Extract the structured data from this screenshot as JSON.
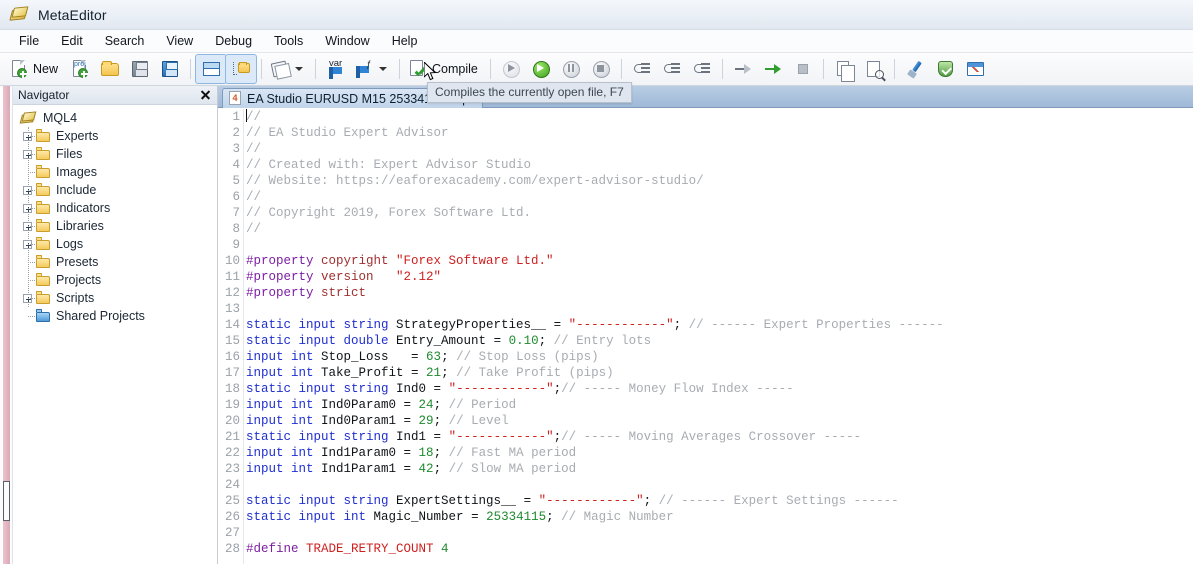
{
  "window": {
    "title": "MetaEditor",
    "logo_icon": "metaeditor-logo-icon"
  },
  "menubar": {
    "items": [
      {
        "label": "File"
      },
      {
        "label": "Edit"
      },
      {
        "label": "Search"
      },
      {
        "label": "View"
      },
      {
        "label": "Debug"
      },
      {
        "label": "Tools"
      },
      {
        "label": "Window"
      },
      {
        "label": "Help"
      }
    ]
  },
  "toolbar": {
    "new_label": "New",
    "compile_label": "Compile",
    "items": [
      {
        "name": "new-file-button",
        "icon": "new-document-icon",
        "label": "New"
      },
      {
        "name": "new-project-button",
        "icon": "new-project-icon",
        "label": ""
      },
      {
        "name": "open-button",
        "icon": "open-folder-icon",
        "label": ""
      },
      {
        "name": "save-button",
        "icon": "save-floppy-icon",
        "label": ""
      },
      {
        "name": "save-all-button",
        "icon": "save-all-floppy-icon",
        "label": ""
      },
      {
        "name": "toggle-panels-button",
        "icon": "split-pane-icon",
        "label": ""
      },
      {
        "name": "toggle-navigator-button",
        "icon": "folder-structure-icon",
        "label": ""
      },
      {
        "name": "style-button",
        "icon": "stacked-pages-icon",
        "label": ""
      },
      {
        "name": "watch-variable-button",
        "icon": "var-flag-icon",
        "label": ""
      },
      {
        "name": "function-bookmark-button",
        "icon": "function-flag-icon",
        "label": ""
      },
      {
        "name": "compile-button",
        "icon": "compile-check-icon",
        "label": "Compile"
      },
      {
        "name": "debug-history-button",
        "icon": "debug-replay-icon",
        "label": ""
      },
      {
        "name": "start-debug-button",
        "icon": "play-green-icon",
        "label": ""
      },
      {
        "name": "pause-debug-button",
        "icon": "pause-icon",
        "label": ""
      },
      {
        "name": "stop-debug-button",
        "icon": "stop-icon",
        "label": ""
      },
      {
        "name": "step-over-button",
        "icon": "step-over-icon",
        "label": ""
      },
      {
        "name": "step-into-button",
        "icon": "step-into-icon",
        "label": ""
      },
      {
        "name": "step-out-button",
        "icon": "step-out-icon",
        "label": ""
      },
      {
        "name": "run-to-cursor-button",
        "icon": "run-arrow-gray-icon",
        "label": ""
      },
      {
        "name": "continue-button",
        "icon": "run-arrow-green-icon",
        "label": ""
      },
      {
        "name": "stop-run-button",
        "icon": "stop-square-icon",
        "label": ""
      },
      {
        "name": "copy-button",
        "icon": "copy-pages-icon",
        "label": ""
      },
      {
        "name": "find-in-file-button",
        "icon": "page-search-icon",
        "label": ""
      },
      {
        "name": "style-format-button",
        "icon": "brush-icon",
        "label": ""
      },
      {
        "name": "mql5-community-button",
        "icon": "shield-icon",
        "label": ""
      },
      {
        "name": "open-chart-button",
        "icon": "chart-window-icon",
        "label": ""
      }
    ]
  },
  "tooltip": {
    "text": "Compiles the currently open file, F7"
  },
  "navigator": {
    "title": "Navigator",
    "close_icon": "close-icon",
    "root": {
      "label": "MQL4",
      "icon": "mql4-root-icon"
    },
    "items": [
      {
        "label": "Experts",
        "expandable": true,
        "folder": "yellow"
      },
      {
        "label": "Files",
        "expandable": true,
        "folder": "yellow"
      },
      {
        "label": "Images",
        "expandable": false,
        "folder": "yellow"
      },
      {
        "label": "Include",
        "expandable": true,
        "folder": "yellow"
      },
      {
        "label": "Indicators",
        "expandable": true,
        "folder": "yellow"
      },
      {
        "label": "Libraries",
        "expandable": true,
        "folder": "yellow"
      },
      {
        "label": "Logs",
        "expandable": true,
        "folder": "yellow"
      },
      {
        "label": "Presets",
        "expandable": false,
        "folder": "yellow"
      },
      {
        "label": "Projects",
        "expandable": false,
        "folder": "yellow"
      },
      {
        "label": "Scripts",
        "expandable": true,
        "folder": "yellow"
      },
      {
        "label": "Shared Projects",
        "expandable": false,
        "folder": "blue"
      }
    ]
  },
  "editor": {
    "tab": {
      "label": "EA Studio EURUSD M15 25334115.mq4",
      "icon": "mq4-file-icon"
    },
    "lines": [
      {
        "n": "1",
        "tokens": [
          {
            "t": "caret"
          },
          {
            "c": "cm",
            "s": "//"
          }
        ]
      },
      {
        "n": "2",
        "tokens": [
          {
            "c": "cm",
            "s": "// EA Studio Expert Advisor"
          }
        ]
      },
      {
        "n": "3",
        "tokens": [
          {
            "c": "cm",
            "s": "//"
          }
        ]
      },
      {
        "n": "4",
        "tokens": [
          {
            "c": "cm",
            "s": "// Created with: Expert Advisor Studio"
          }
        ]
      },
      {
        "n": "5",
        "tokens": [
          {
            "c": "cm",
            "s": "// Website: https://eaforexacademy.com/expert-advisor-studio/"
          }
        ]
      },
      {
        "n": "6",
        "tokens": [
          {
            "c": "cm",
            "s": "//"
          }
        ]
      },
      {
        "n": "7",
        "tokens": [
          {
            "c": "cm",
            "s": "// Copyright 2019, Forex Software Ltd."
          }
        ]
      },
      {
        "n": "8",
        "tokens": [
          {
            "c": "cm",
            "s": "//"
          }
        ]
      },
      {
        "n": "9",
        "tokens": []
      },
      {
        "n": "10",
        "tokens": [
          {
            "c": "pp",
            "s": "#property "
          },
          {
            "c": "ppk",
            "s": "copyright "
          },
          {
            "c": "str",
            "s": "\"Forex Software Ltd.\""
          }
        ]
      },
      {
        "n": "11",
        "tokens": [
          {
            "c": "pp",
            "s": "#property "
          },
          {
            "c": "ppk",
            "s": "version   "
          },
          {
            "c": "str",
            "s": "\"2.12\""
          }
        ]
      },
      {
        "n": "12",
        "tokens": [
          {
            "c": "pp",
            "s": "#property "
          },
          {
            "c": "ppk",
            "s": "strict"
          }
        ]
      },
      {
        "n": "13",
        "tokens": []
      },
      {
        "n": "14",
        "tokens": [
          {
            "c": "kw",
            "s": "static input string "
          },
          {
            "c": "id",
            "s": "StrategyProperties__ "
          },
          {
            "c": "op",
            "s": "= "
          },
          {
            "c": "str",
            "s": "\"------------\""
          },
          {
            "c": "op",
            "s": "; "
          },
          {
            "c": "cm",
            "s": "// ------ Expert Properties ------"
          }
        ]
      },
      {
        "n": "15",
        "tokens": [
          {
            "c": "kw",
            "s": "static input double "
          },
          {
            "c": "id",
            "s": "Entry_Amount "
          },
          {
            "c": "op",
            "s": "= "
          },
          {
            "c": "num",
            "s": "0.10"
          },
          {
            "c": "op",
            "s": "; "
          },
          {
            "c": "cm",
            "s": "// Entry lots"
          }
        ]
      },
      {
        "n": "16",
        "tokens": [
          {
            "c": "kw",
            "s": "input int "
          },
          {
            "c": "id",
            "s": "Stop_Loss   "
          },
          {
            "c": "op",
            "s": "= "
          },
          {
            "c": "num",
            "s": "63"
          },
          {
            "c": "op",
            "s": "; "
          },
          {
            "c": "cm",
            "s": "// Stop Loss (pips)"
          }
        ]
      },
      {
        "n": "17",
        "tokens": [
          {
            "c": "kw",
            "s": "input int "
          },
          {
            "c": "id",
            "s": "Take_Profit "
          },
          {
            "c": "op",
            "s": "= "
          },
          {
            "c": "num",
            "s": "21"
          },
          {
            "c": "op",
            "s": "; "
          },
          {
            "c": "cm",
            "s": "// Take Profit (pips)"
          }
        ]
      },
      {
        "n": "18",
        "tokens": [
          {
            "c": "kw",
            "s": "static input string "
          },
          {
            "c": "id",
            "s": "Ind0 "
          },
          {
            "c": "op",
            "s": "= "
          },
          {
            "c": "str",
            "s": "\"------------\""
          },
          {
            "c": "op",
            "s": ";"
          },
          {
            "c": "cm",
            "s": "// ----- Money Flow Index -----"
          }
        ]
      },
      {
        "n": "19",
        "tokens": [
          {
            "c": "kw",
            "s": "input int "
          },
          {
            "c": "id",
            "s": "Ind0Param0 "
          },
          {
            "c": "op",
            "s": "= "
          },
          {
            "c": "num",
            "s": "24"
          },
          {
            "c": "op",
            "s": "; "
          },
          {
            "c": "cm",
            "s": "// Period"
          }
        ]
      },
      {
        "n": "20",
        "tokens": [
          {
            "c": "kw",
            "s": "input int "
          },
          {
            "c": "id",
            "s": "Ind0Param1 "
          },
          {
            "c": "op",
            "s": "= "
          },
          {
            "c": "num",
            "s": "29"
          },
          {
            "c": "op",
            "s": "; "
          },
          {
            "c": "cm",
            "s": "// Level"
          }
        ]
      },
      {
        "n": "21",
        "tokens": [
          {
            "c": "kw",
            "s": "static input string "
          },
          {
            "c": "id",
            "s": "Ind1 "
          },
          {
            "c": "op",
            "s": "= "
          },
          {
            "c": "str",
            "s": "\"------------\""
          },
          {
            "c": "op",
            "s": ";"
          },
          {
            "c": "cm",
            "s": "// ----- Moving Averages Crossover -----"
          }
        ]
      },
      {
        "n": "22",
        "tokens": [
          {
            "c": "kw",
            "s": "input int "
          },
          {
            "c": "id",
            "s": "Ind1Param0 "
          },
          {
            "c": "op",
            "s": "= "
          },
          {
            "c": "num",
            "s": "18"
          },
          {
            "c": "op",
            "s": "; "
          },
          {
            "c": "cm",
            "s": "// Fast MA period"
          }
        ]
      },
      {
        "n": "23",
        "tokens": [
          {
            "c": "kw",
            "s": "input int "
          },
          {
            "c": "id",
            "s": "Ind1Param1 "
          },
          {
            "c": "op",
            "s": "= "
          },
          {
            "c": "num",
            "s": "42"
          },
          {
            "c": "op",
            "s": "; "
          },
          {
            "c": "cm",
            "s": "// Slow MA period"
          }
        ]
      },
      {
        "n": "24",
        "tokens": []
      },
      {
        "n": "25",
        "tokens": [
          {
            "c": "kw",
            "s": "static input string "
          },
          {
            "c": "id",
            "s": "ExpertSettings__ "
          },
          {
            "c": "op",
            "s": "= "
          },
          {
            "c": "str",
            "s": "\"------------\""
          },
          {
            "c": "op",
            "s": "; "
          },
          {
            "c": "cm",
            "s": "// ------ Expert Settings ------"
          }
        ]
      },
      {
        "n": "26",
        "tokens": [
          {
            "c": "kw",
            "s": "static input int "
          },
          {
            "c": "id",
            "s": "Magic_Number "
          },
          {
            "c": "op",
            "s": "= "
          },
          {
            "c": "num",
            "s": "25334115"
          },
          {
            "c": "op",
            "s": "; "
          },
          {
            "c": "cm",
            "s": "// Magic Number"
          }
        ]
      },
      {
        "n": "27",
        "tokens": []
      },
      {
        "n": "28",
        "tokens": [
          {
            "c": "pp",
            "s": "#define "
          },
          {
            "c": "define",
            "s": "TRADE_RETRY_COUNT "
          },
          {
            "c": "num",
            "s": "4"
          }
        ]
      }
    ]
  },
  "colors": {
    "comment": "#a8acb2",
    "keyword": "#1f2fd0",
    "preprocessor": "#7b1fa2",
    "string": "#cf2020",
    "number": "#1f8a2f",
    "tab_active_bg": "#cfdff1"
  }
}
